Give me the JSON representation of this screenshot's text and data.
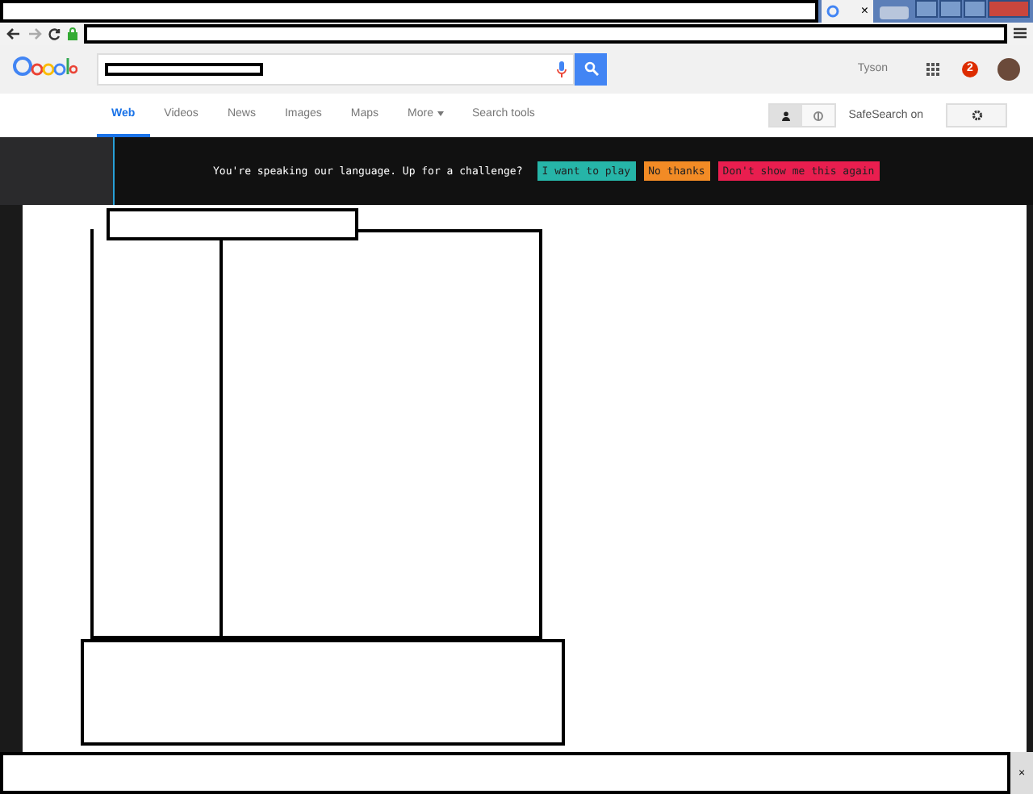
{
  "browser_tab": {
    "close": "×"
  },
  "google_bar": {
    "user": "Tyson",
    "notifications": "2"
  },
  "tabs": [
    {
      "label": "Web",
      "selected": true
    },
    {
      "label": "Videos",
      "selected": false
    },
    {
      "label": "News",
      "selected": false
    },
    {
      "label": "Images",
      "selected": false
    },
    {
      "label": "Maps",
      "selected": false
    },
    {
      "label": "More",
      "selected": false,
      "dropdown": true
    },
    {
      "label": "Search tools",
      "selected": false
    }
  ],
  "view_toggle": [
    {
      "kind": "person",
      "selected": true
    },
    {
      "kind": "globe",
      "selected": false
    }
  ],
  "safesearch": "SafeSearch on",
  "banner": {
    "text": "You're speaking our language. Up for a challenge?",
    "buttons": [
      {
        "label": "I want to play",
        "color": "#26b5a8"
      },
      {
        "label": "No thanks",
        "color": "#f28b25"
      },
      {
        "label": "Don't show me this again",
        "color": "#e91e4f"
      }
    ]
  },
  "bottom_bar": {
    "close": "×"
  }
}
